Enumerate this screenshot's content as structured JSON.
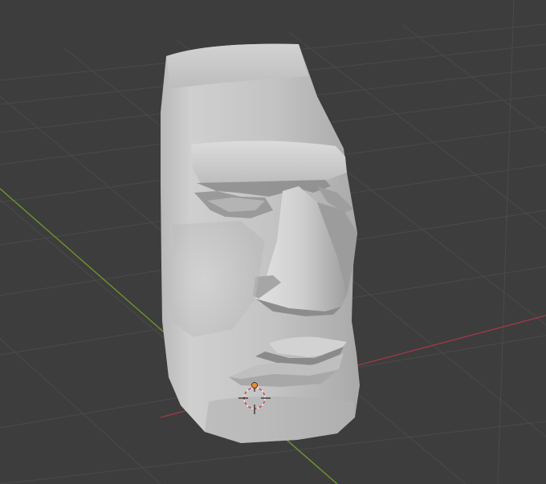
{
  "viewport": {
    "background": "#3d3d3d",
    "grid_color": "#4a4a4a",
    "x_axis_color": "#a33a46",
    "y_axis_color": "#6e9a2b"
  },
  "scene": {
    "object": "moai-head-mesh",
    "mesh_color": "#c8c8c8",
    "origin_marker": "3d-cursor-icon"
  }
}
